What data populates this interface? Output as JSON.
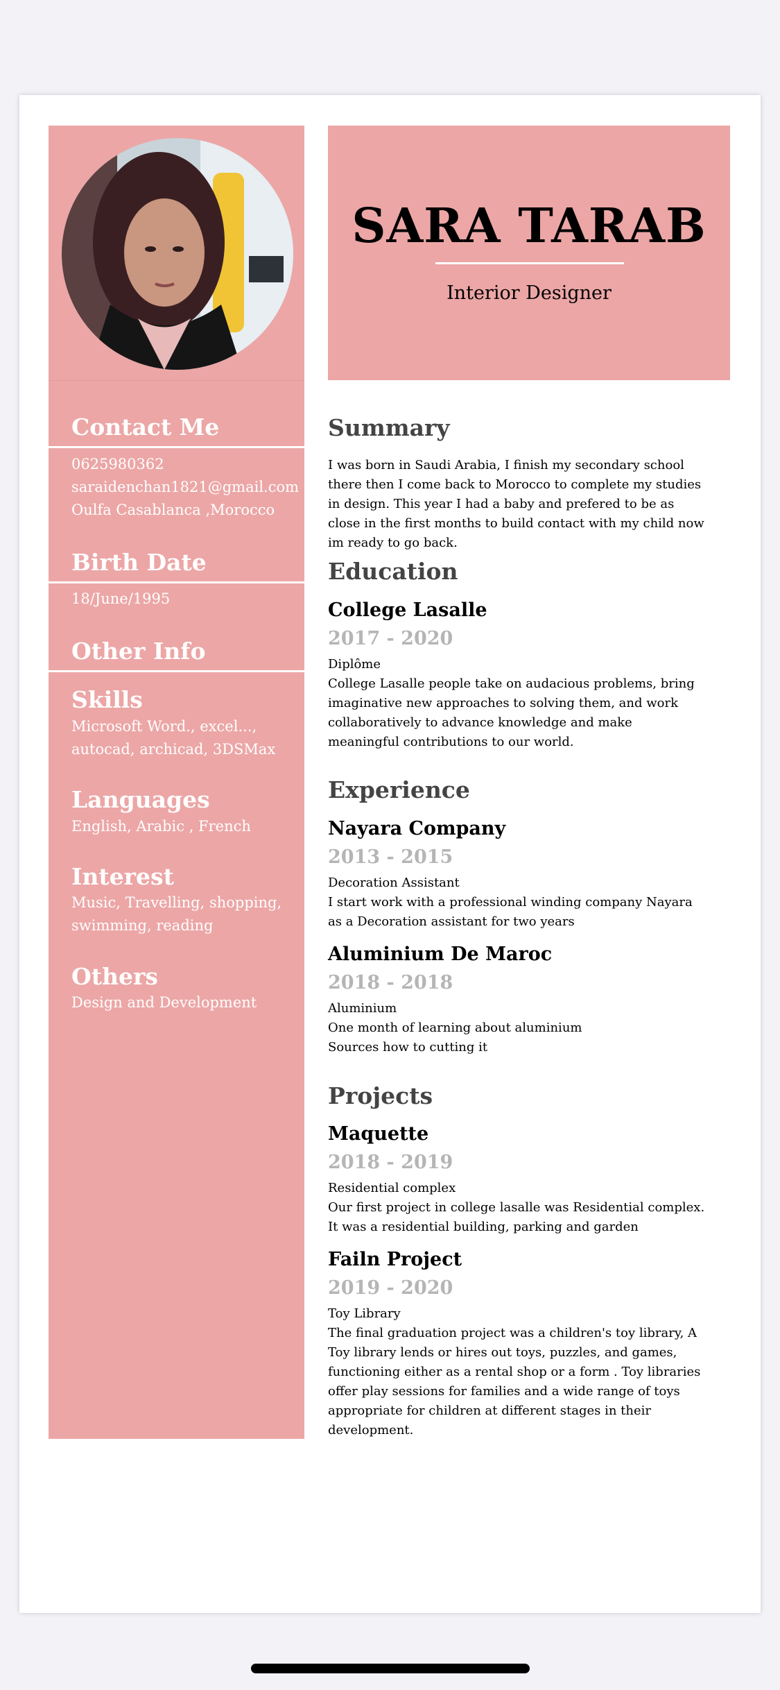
{
  "header": {
    "name": "SARA TARAB",
    "role": "Interior Designer"
  },
  "sidebar": {
    "contact": {
      "heading": "Contact Me",
      "phone": "0625980362",
      "email": "saraidenchan1821@gmail.com",
      "address": "Oulfa  Casablanca ,Morocco"
    },
    "birth": {
      "heading": "Birth Date",
      "value": "18/June/1995"
    },
    "other_info": {
      "heading": "Other Info"
    },
    "skills": {
      "heading": "Skills",
      "value": "Microsoft Word., excel..., autocad, archicad, 3DSMax"
    },
    "languages": {
      "heading": "Languages",
      "value": "English, Arabic , French"
    },
    "interest": {
      "heading": "Interest",
      "value": "Music, Travelling, shopping, swimming, reading"
    },
    "others": {
      "heading": "Others",
      "value": "Design and Development"
    }
  },
  "summary": {
    "heading": "Summary",
    "text": "I was born in Saudi Arabia, I finish my secondary school there then I come back to Morocco to complete my studies in design. This year I had a baby and prefered to be as close in the first months to build contact with my child now im ready to go back."
  },
  "education": {
    "heading": "Education",
    "items": [
      {
        "title": "College Lasalle",
        "years": "2017  - 2020",
        "subtitle": "Diplôme",
        "desc": "College Lasalle people take on audacious problems, bring imaginative new approaches to solving them, and work collaboratively to advance knowledge and make meaningful contributions to our world."
      }
    ]
  },
  "experience": {
    "heading": "Experience",
    "items": [
      {
        "title": " Nayara Company",
        "years": "2013 - 2015",
        "subtitle": "Decoration Assistant",
        "desc": "I start work with a professional winding company Nayara as a Decoration assistant for two years"
      },
      {
        "title": "Aluminium De Maroc",
        "years": "2018 - 2018",
        "subtitle": "Aluminium",
        "desc": "One month of learning about aluminium",
        "desc2": "Sources how to cutting it"
      }
    ]
  },
  "projects": {
    "heading": "Projects",
    "items": [
      {
        "title": "Maquette",
        "years": "2018 - 2019",
        "subtitle": "Residential complex",
        "desc": "Our first project in college lasalle was Residential complex. It was a residential building, parking and garden"
      },
      {
        "title": "Failn Project",
        "years": "2019 - 2020",
        "subtitle": "Toy Library",
        "desc": "The final graduation project was a children's toy library, A Toy library lends or hires out toys, puzzles, and games, functioning either as a rental shop or a form . Toy libraries offer play sessions for families and a wide range of toys appropriate for children at different stages in their development."
      }
    ]
  }
}
